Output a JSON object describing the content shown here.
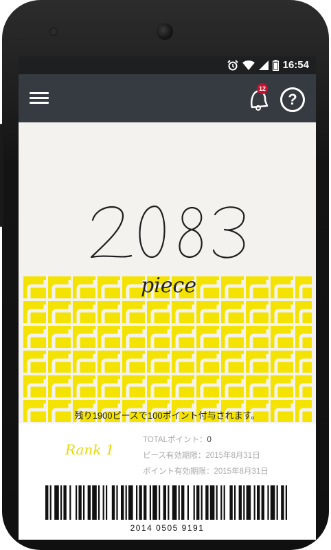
{
  "status_bar": {
    "time": "16:54"
  },
  "app_bar": {
    "notification_count": "12",
    "help_label": "?"
  },
  "points": {
    "count": "2083",
    "unit": "piece",
    "remaining_message": "残り1900ピースで100ポイント付与されます。"
  },
  "card": {
    "rank": "Rank 1",
    "total_points_label": "TOTALポイント：",
    "total_points_value": "0",
    "piece_expiry_label": "ピース有効期限：",
    "piece_expiry_value": "2015年8月31日",
    "point_expiry_label": "ポイント有効期限：",
    "point_expiry_value": "2015年8月31日",
    "barcode_number": "2014 0505 9191"
  },
  "colors": {
    "tile": "#f4e300",
    "app_bar": "#353b40",
    "status_bar": "#1d1f21",
    "badge": "#c8102e"
  },
  "icons": [
    "alarm-icon",
    "wifi-icon",
    "signal-icon",
    "battery-icon",
    "menu-icon",
    "bell-icon",
    "help-icon"
  ]
}
